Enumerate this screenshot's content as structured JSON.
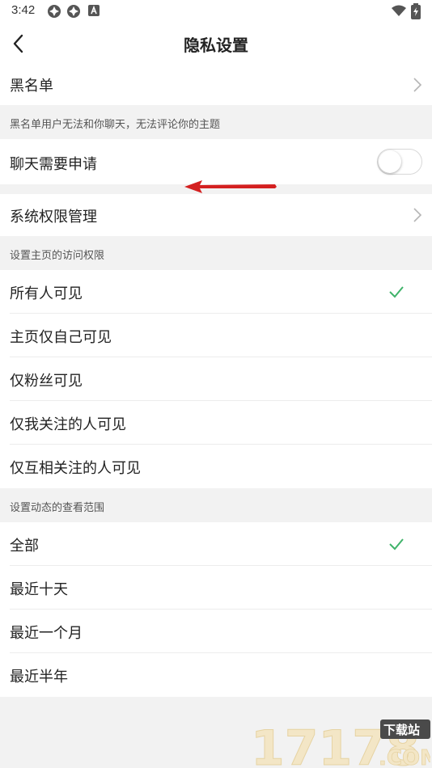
{
  "status_bar": {
    "time": "3:42"
  },
  "header": {
    "title": "隐私设置"
  },
  "blacklist": {
    "label": "黑名单",
    "hint": "黑名单用户无法和你聊天，无法评论你的主题"
  },
  "chat_request": {
    "label": "聊天需要申请",
    "enabled": false
  },
  "system_permissions": {
    "label": "系统权限管理"
  },
  "homepage_visibility": {
    "section_title": "设置主页的访问权限",
    "options": [
      {
        "label": "所有人可见",
        "selected": true
      },
      {
        "label": "主页仅自己可见",
        "selected": false
      },
      {
        "label": "仅粉丝可见",
        "selected": false
      },
      {
        "label": "仅我关注的人可见",
        "selected": false
      },
      {
        "label": "仅互相关注的人可见",
        "selected": false
      }
    ]
  },
  "feed_range": {
    "section_title": "设置动态的查看范围",
    "options": [
      {
        "label": "全部",
        "selected": true
      },
      {
        "label": "最近十天",
        "selected": false
      },
      {
        "label": "最近一个月",
        "selected": false
      },
      {
        "label": "最近半年",
        "selected": false
      }
    ]
  },
  "watermark": {
    "number": "17178",
    "domain": ".COM",
    "tag": "下载站"
  },
  "colors": {
    "check": "#3fb36a",
    "annotation_arrow": "#d42020"
  }
}
